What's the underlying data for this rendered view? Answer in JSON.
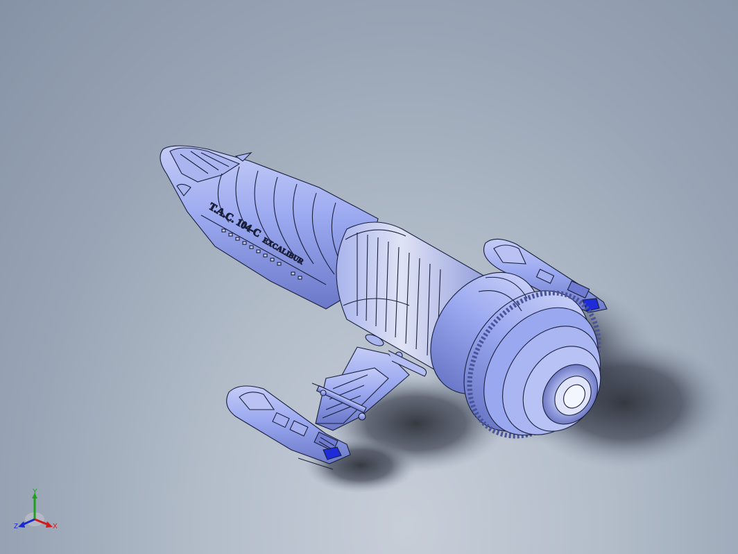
{
  "model": {
    "designation_text": "T.A.C. 104-C",
    "name_text": "EXCALIBUR",
    "hull_color": "#8f9ef0",
    "hull_shadow_color": "#5a66b0",
    "accent_color": "#1d2bd8",
    "edge_color": "#1a1f3a"
  },
  "triad": {
    "x_label": "X",
    "y_label": "Y",
    "z_label": "Z",
    "x_color": "#d21a1a",
    "y_color": "#1ea01e",
    "z_color": "#1a2ad2"
  }
}
